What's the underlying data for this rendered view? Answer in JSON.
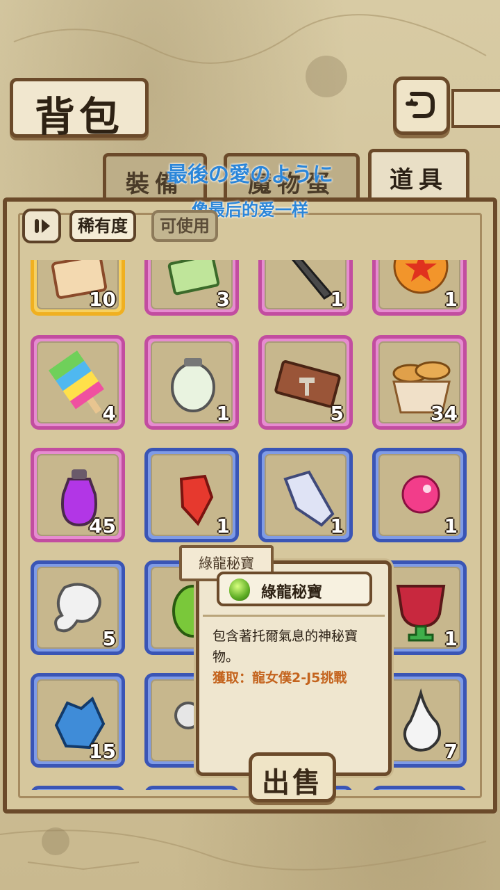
{
  "header": {
    "title": "背包"
  },
  "tabs": [
    {
      "label": "裝備",
      "active": false
    },
    {
      "label": "魔物蛋",
      "active": false
    },
    {
      "label": "道具",
      "active": true
    }
  ],
  "overlay": {
    "lyric_jp": "最後の愛のように",
    "lyric_cn": "像最后的爱一样"
  },
  "filters": {
    "rarity": "稀有度",
    "usable": "可使用"
  },
  "items": [
    {
      "icon": "ticket-icon",
      "count": "10",
      "rarity": "gold"
    },
    {
      "icon": "bunny-card-icon",
      "count": "3",
      "rarity": "pink"
    },
    {
      "icon": "dagger-icon",
      "count": "1",
      "rarity": "pink"
    },
    {
      "icon": "star-orb-icon",
      "count": "1",
      "rarity": "pink"
    },
    {
      "icon": "rainbow-popsicle-icon",
      "count": "4",
      "rarity": "pink"
    },
    {
      "icon": "lantern-icon",
      "count": "1",
      "rarity": "pink"
    },
    {
      "icon": "hammer-ticket-icon",
      "count": "5",
      "rarity": "pink"
    },
    {
      "icon": "bread-basket-icon",
      "count": "34",
      "rarity": "pink"
    },
    {
      "icon": "purple-potion-icon",
      "count": "45",
      "rarity": "pink"
    },
    {
      "icon": "red-crystal-icon",
      "count": "1",
      "rarity": "blue"
    },
    {
      "icon": "white-crystal-icon",
      "count": "1",
      "rarity": "blue"
    },
    {
      "icon": "pink-orb-icon",
      "count": "1",
      "rarity": "blue"
    },
    {
      "icon": "cloud-icon",
      "count": "5",
      "rarity": "blue"
    },
    {
      "icon": "green-egg-icon",
      "count": "",
      "rarity": "blue"
    },
    {
      "icon": "hidden-icon",
      "count": "",
      "rarity": "blue"
    },
    {
      "icon": "red-drink-icon",
      "count": "1",
      "rarity": "blue"
    },
    {
      "icon": "blue-ore-icon",
      "count": "15",
      "rarity": "blue"
    },
    {
      "icon": "pendant-icon",
      "count": "",
      "rarity": "blue"
    },
    {
      "icon": "hidden-icon",
      "count": "",
      "rarity": "blue"
    },
    {
      "icon": "white-flame-icon",
      "count": "7",
      "rarity": "blue"
    }
  ],
  "tooltip": {
    "label": "綠龍秘寶",
    "name": "綠龍秘寶",
    "description": "包含著托爾氣息的神秘寶物。",
    "source": "獲取：龍女僕2-J5挑戰",
    "sell_label": "出售"
  }
}
